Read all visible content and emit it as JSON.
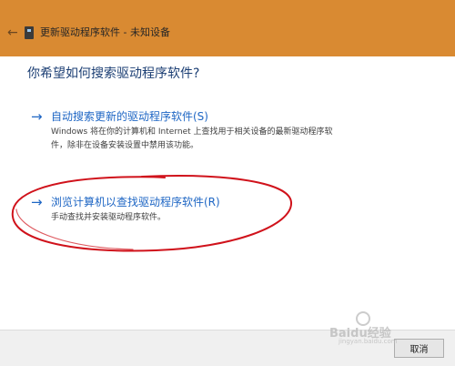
{
  "window": {
    "back_glyph": "←",
    "title": "更新驱动程序软件 - 未知设备"
  },
  "heading": "你希望如何搜索驱动程序软件?",
  "options": [
    {
      "arrow": "→",
      "title": "自动搜索更新的驱动程序软件(S)",
      "description_lines": [
        "Windows 将在你的计算机和 Internet 上查找用于相关设备的最新驱动程序软",
        "件，除非在设备安装设置中禁用该功能。"
      ]
    },
    {
      "arrow": "→",
      "title": "浏览计算机以查找驱动程序软件(R)",
      "description_lines": [
        "手动查找并安装驱动程序软件。"
      ]
    }
  ],
  "buttons": {
    "cancel": "取消"
  },
  "watermark": {
    "brand": "Baidu经验",
    "url": "jingyan.baidu.com"
  },
  "colors": {
    "titlebar": "#d98a32",
    "link": "#1e66c4",
    "heading": "#1c3f74",
    "annotation": "#d0121b"
  },
  "icons": {
    "back": "back-arrow-icon",
    "device": "device-icon",
    "option_arrow": "right-arrow-icon"
  }
}
